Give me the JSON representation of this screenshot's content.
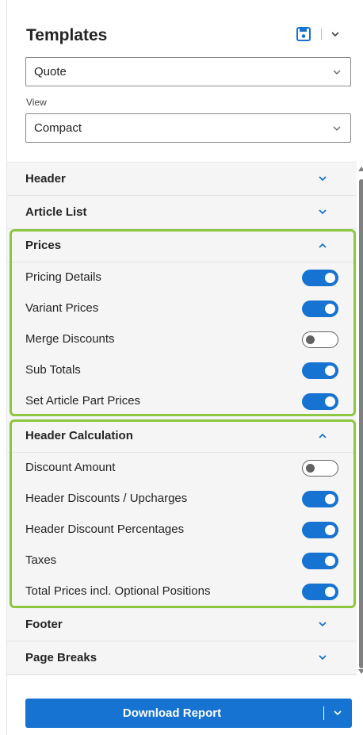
{
  "templates": {
    "title": "Templates",
    "save_icon": "save-icon",
    "template_value": "Quote",
    "view_label": "View",
    "view_value": "Compact"
  },
  "sections": {
    "header": {
      "label": "Header",
      "expanded": false
    },
    "article_list": {
      "label": "Article List",
      "expanded": false
    },
    "prices": {
      "label": "Prices",
      "expanded": true,
      "items": [
        {
          "label": "Pricing Details",
          "on": true
        },
        {
          "label": "Variant Prices",
          "on": true
        },
        {
          "label": "Merge Discounts",
          "on": false
        },
        {
          "label": "Sub Totals",
          "on": true
        },
        {
          "label": "Set Article Part Prices",
          "on": true
        }
      ]
    },
    "header_calculation": {
      "label": "Header Calculation",
      "expanded": true,
      "items": [
        {
          "label": "Discount Amount",
          "on": false
        },
        {
          "label": "Header Discounts / Upcharges",
          "on": true
        },
        {
          "label": "Header Discount Percentages",
          "on": true
        },
        {
          "label": "Taxes",
          "on": true
        },
        {
          "label": "Total Prices incl. Optional Positions",
          "on": true
        }
      ]
    },
    "footer": {
      "label": "Footer",
      "expanded": false
    },
    "page_breaks": {
      "label": "Page Breaks",
      "expanded": false
    }
  },
  "actions": {
    "download_label": "Download Report"
  },
  "colors": {
    "accent": "#1673d1",
    "highlight": "#8dc63f",
    "toggle_off": "#616161"
  }
}
